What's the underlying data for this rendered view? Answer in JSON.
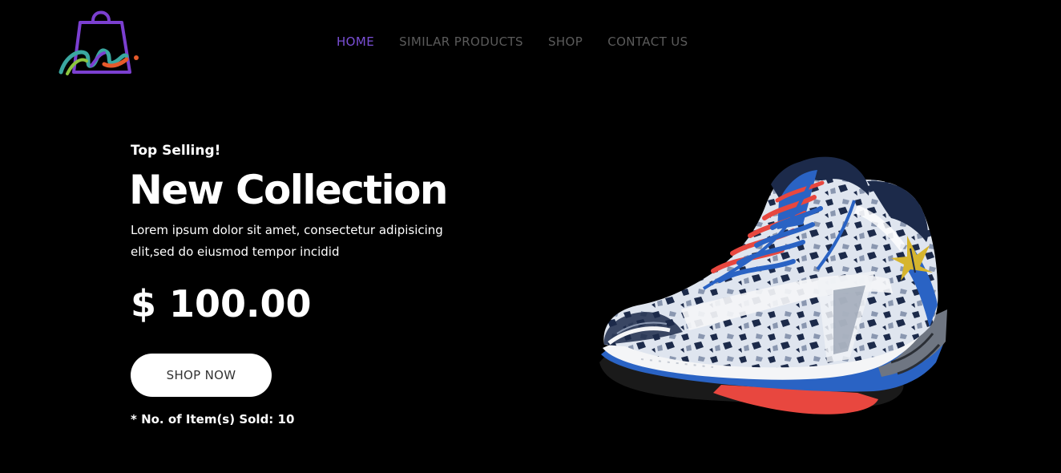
{
  "header": {
    "logo_icon": "shopping-bag-logo",
    "logo_letter": "m",
    "nav": [
      {
        "label": "HOME",
        "active": true
      },
      {
        "label": "SIMILAR PRODUCTS",
        "active": false
      },
      {
        "label": "SHOP",
        "active": false
      },
      {
        "label": "CONTACT US",
        "active": false
      }
    ]
  },
  "hero": {
    "tagline": "Top Selling!",
    "title": "New Collection",
    "description": "Lorem ipsum dolor sit amet, consectetur adipisicing elit,sed do eiusmod tempor incidid",
    "price": "$ 100.00",
    "cta_label": "SHOP NOW",
    "sold_text": "* No. of Item(s) Sold: 10"
  },
  "product": {
    "image_icon": "running-shoe-image"
  },
  "colors": {
    "background": "#000000",
    "nav_active": "#7a4fd6",
    "nav_inactive": "#5b5b5b",
    "button_bg": "#ffffff",
    "button_text": "#333333",
    "shoe_blue": "#2a63c4",
    "shoe_navy": "#1c2a4a",
    "shoe_red": "#e8473f",
    "shoe_yellow": "#d6b52e"
  }
}
